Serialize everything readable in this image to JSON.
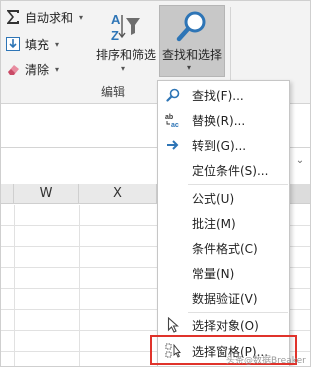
{
  "ribbon": {
    "editing_commands": [
      {
        "label": "自动求和",
        "icon": "autosum-sigma-icon",
        "has_dropdown": true
      },
      {
        "label": "填充",
        "icon": "fill-down-arrow-icon",
        "has_dropdown": true
      },
      {
        "label": "清除",
        "icon": "eraser-clear-icon",
        "has_dropdown": true
      }
    ],
    "sort_filter": {
      "label": "排序和筛选",
      "icon": "sort-filter-az-icon"
    },
    "find_select": {
      "label": "查找和选择",
      "icon": "magnifier-search-icon",
      "active": true
    },
    "group_label": "编辑"
  },
  "sheet": {
    "column_headers": [
      "W",
      "X"
    ]
  },
  "menu": {
    "items": [
      {
        "label": "查找(F)...",
        "icon": "magnifier-search-icon"
      },
      {
        "label": "替换(R)...",
        "icon": "replace-ab-ac-icon"
      },
      {
        "label": "转到(G)...",
        "icon": "goto-arrow-icon"
      },
      {
        "label": "定位条件(S)...",
        "icon": ""
      },
      {
        "label": "公式(U)",
        "icon": ""
      },
      {
        "label": "批注(M)",
        "icon": ""
      },
      {
        "label": "条件格式(C)",
        "icon": ""
      },
      {
        "label": "常量(N)",
        "icon": ""
      },
      {
        "label": "数据验证(V)",
        "icon": ""
      },
      {
        "label": "选择对象(O)",
        "icon": "select-objects-cursor-icon"
      },
      {
        "label": "选择窗格(P)...",
        "icon": "selection-pane-icon"
      }
    ],
    "highlighted_item": "选择窗格(P)..."
  },
  "watermark": "头条@数据Breaker",
  "colors": {
    "ribbon_bg": "#f3f3f3",
    "active_button_bg": "#c8c8c8",
    "accent_blue": "#2e75b6",
    "highlight_red": "#e0332b"
  }
}
